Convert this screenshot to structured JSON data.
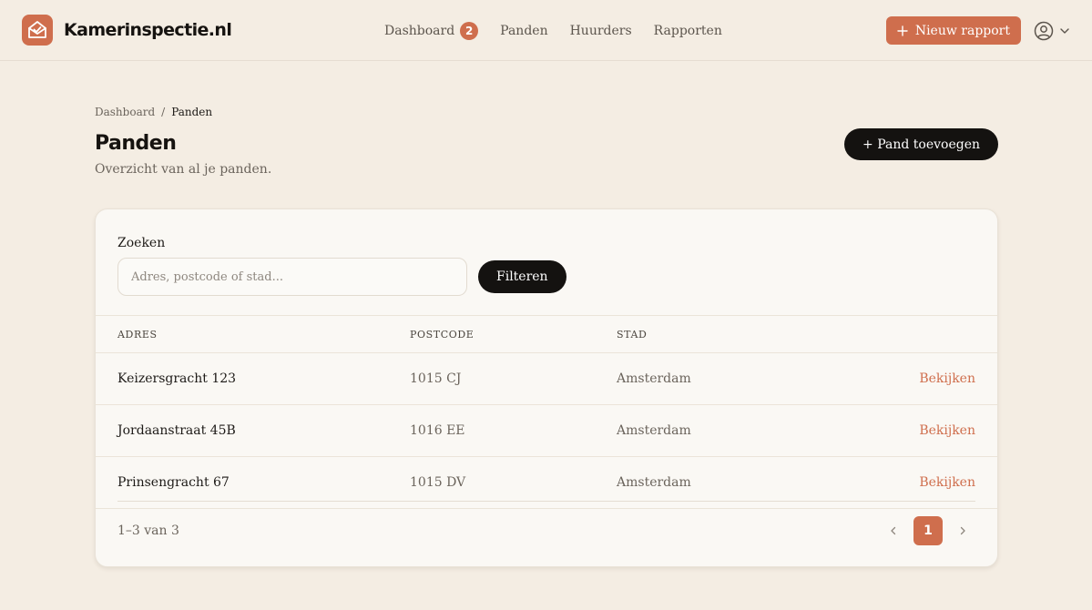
{
  "brand": {
    "name": "Kamerinspectie.nl",
    "logo_icon": "house-envelope-icon",
    "accent": "#cf6e4d"
  },
  "nav": {
    "items": [
      {
        "label": "Dashboard",
        "badge": "2"
      },
      {
        "label": "Panden"
      },
      {
        "label": "Huurders"
      },
      {
        "label": "Rapporten"
      }
    ]
  },
  "header": {
    "new_report_label": "Nieuw rapport",
    "account_icon": "user-circle-icon"
  },
  "breadcrumb": {
    "parent": "Dashboard",
    "separator": "/",
    "current": "Panden"
  },
  "page": {
    "title": "Panden",
    "subtitle": "Overzicht van al je panden.",
    "add_button_label": "+ Pand toevoegen"
  },
  "search": {
    "label": "Zoeken",
    "placeholder": "Adres, postcode of stad...",
    "value": "",
    "filter_label": "Filteren"
  },
  "table": {
    "columns": [
      "ADRES",
      "POSTCODE",
      "STAD"
    ],
    "rows": [
      {
        "adres": "Keizersgracht 123",
        "postcode": "1015 CJ",
        "stad": "Amsterdam",
        "action": "Bekijken"
      },
      {
        "adres": "Jordaanstraat 45B",
        "postcode": "1016 EE",
        "stad": "Amsterdam",
        "action": "Bekijken"
      },
      {
        "adres": "Prinsengracht 67",
        "postcode": "1015 DV",
        "stad": "Amsterdam",
        "action": "Bekijken"
      }
    ]
  },
  "pagination": {
    "range_text": "1–3 van 3",
    "current_page": "1"
  }
}
